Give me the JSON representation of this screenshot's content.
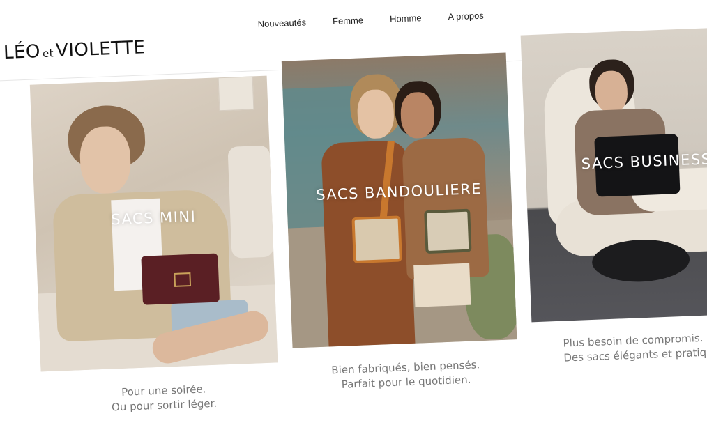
{
  "brand": {
    "logo_main": "LÉO",
    "logo_et": "et",
    "logo_end": "VIOLETTE"
  },
  "nav": [
    "Nouveautés",
    "Femme",
    "Homme",
    "A propos"
  ],
  "header_icons": [
    "search-icon",
    "account-icon",
    "bag-icon"
  ],
  "cards": [
    {
      "title": "SACS MINI",
      "caption_line1": "Pour une soirée.",
      "caption_line2": "Ou pour sortir léger."
    },
    {
      "title": "SACS BANDOULIERE",
      "caption_line1": "Bien fabriqués, bien pensés.",
      "caption_line2": "Parfait pour le quotidien."
    },
    {
      "title": "SACS BUSINESS",
      "caption_line1": "Plus besoin de compromis.",
      "caption_line2": "Des sacs élégants et pratiques."
    }
  ],
  "colors": {
    "caption": "#777777",
    "logo": "#111111"
  }
}
